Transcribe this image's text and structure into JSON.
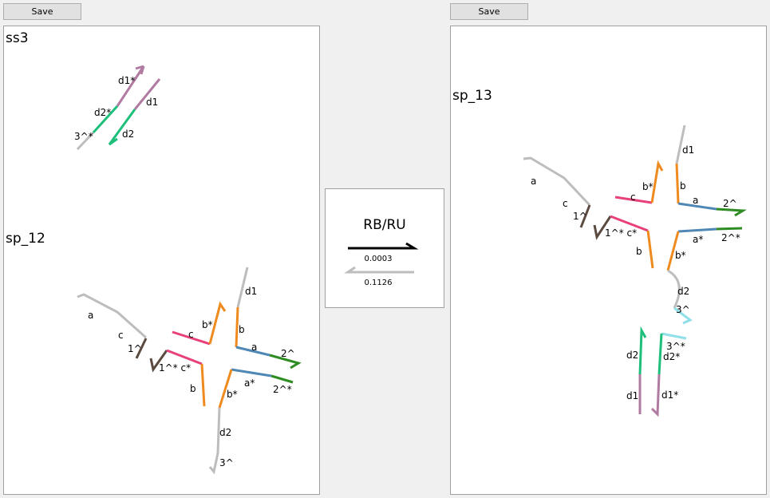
{
  "toolbar": {
    "save_left": "Save",
    "save_right": "Save"
  },
  "colors": {
    "gray": "#bdbdbd",
    "brown": "#5b4a3f",
    "pink": "#e8407a",
    "orange": "#ee8a1e",
    "blue": "#4f87b5",
    "green": "#2e8c22",
    "mauve": "#b07aa1",
    "teal": "#1dbf7a",
    "cyan": "#8fe0e8",
    "arrow_fwd": "#000000",
    "arrow_rev": "#bdbdbd"
  },
  "left": {
    "ss3": {
      "title": "ss3",
      "labels": {
        "d1s": "d1*",
        "d2s": "d2*",
        "t3s": "3^*",
        "d1": "d1",
        "d2": "d2"
      }
    },
    "sp12": {
      "title": "sp_12",
      "labels": {
        "a": "a",
        "c": "c",
        "one": "1^",
        "onecs": "1^* c*",
        "c2": "c",
        "bs": "b*",
        "d1": "d1",
        "b": "b",
        "a2": "a",
        "two": "2^",
        "b2": "b",
        "bs2": "b*",
        "as": "a*",
        "twos": "2^*",
        "d2": "d2",
        "three": "3^"
      }
    }
  },
  "reaction": {
    "name": "RB/RU",
    "forward_rate": "0.0003",
    "reverse_rate": "0.1126"
  },
  "right": {
    "sp13": {
      "title": "sp_13",
      "labels": {
        "d1": "d1",
        "a": "a",
        "bs": "b*",
        "b": "b",
        "c": "c",
        "a2": "a",
        "two": "2^",
        "c2": "c",
        "one": "1^",
        "onecs": "1^* c*",
        "as": "a*",
        "twos": "2^*",
        "b2": "b",
        "bs2": "b*",
        "d2": "d2",
        "three": "3^",
        "threes": "3^*",
        "d2b": "d2",
        "d2s": "d2*",
        "d1b": "d1",
        "d1s": "d1*"
      }
    }
  }
}
